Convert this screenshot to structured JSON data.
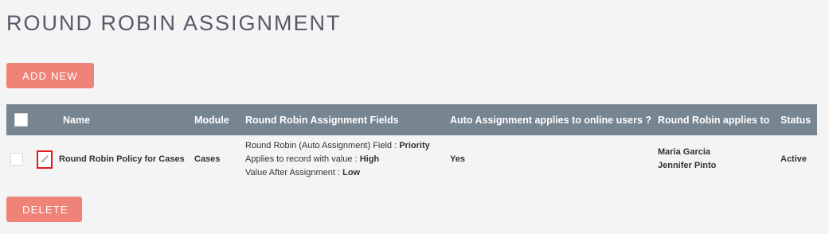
{
  "page": {
    "title": "ROUND ROBIN ASSIGNMENT"
  },
  "actions": {
    "add_new": "ADD NEW",
    "delete": "DELETE"
  },
  "table": {
    "columns": {
      "name": "Name",
      "module": "Module",
      "fields": "Round Robin Assignment Fields",
      "auto": "Auto Assignment applies to online users ?",
      "applies_to": "Round Robin applies to",
      "status": "Status"
    },
    "rows": [
      {
        "name": "Round Robin Policy for Cases",
        "module": "Cases",
        "fields": [
          {
            "label": "Round Robin (Auto Assignment) Field :",
            "value": "Priority"
          },
          {
            "label": "Applies to record with value :",
            "value": "High"
          },
          {
            "label": "Value After Assignment :",
            "value": "Low"
          }
        ],
        "auto_assignment": "Yes",
        "applies_to": [
          "Maria Garcia",
          "Jennifer Pinto"
        ],
        "status": "Active"
      }
    ]
  },
  "icons": {
    "edit": "pencil-icon"
  },
  "colors": {
    "accent": "#f08377",
    "header_bg": "#778591",
    "edit_highlight": "#e31818"
  }
}
